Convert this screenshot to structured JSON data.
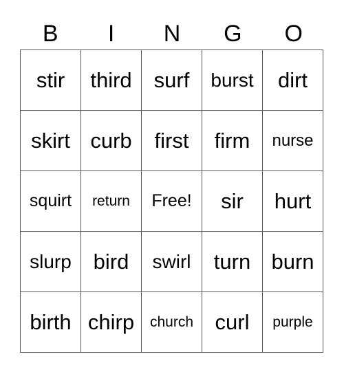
{
  "header": [
    "B",
    "I",
    "N",
    "G",
    "O"
  ],
  "rows": [
    [
      "stir",
      "third",
      "surf",
      "burst",
      "dirt"
    ],
    [
      "skirt",
      "curb",
      "first",
      "firm",
      "nurse"
    ],
    [
      "squirt",
      "return",
      "Free!",
      "sir",
      "hurt"
    ],
    [
      "slurp",
      "bird",
      "swirl",
      "turn",
      "burn"
    ],
    [
      "birth",
      "chirp",
      "church",
      "curl",
      "purple"
    ]
  ]
}
